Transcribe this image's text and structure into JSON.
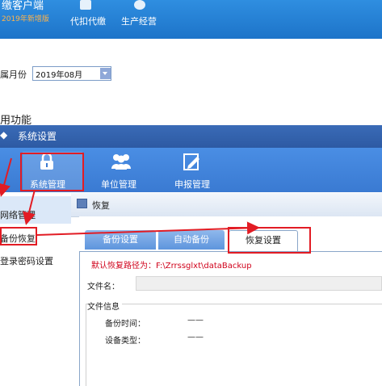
{
  "app_header": {
    "title": "缴客户端",
    "subtitle": "2019年新增版",
    "nav": [
      {
        "label": "代扣代缴"
      },
      {
        "label": "生产经营"
      }
    ]
  },
  "period": {
    "label": "属月份",
    "value": "2019年08月"
  },
  "section_title": "用功能",
  "dialog": {
    "title": "系统设置",
    "toolbar": [
      {
        "label": "系统管理",
        "icon": "lock-icon"
      },
      {
        "label": "单位管理",
        "icon": "users-icon"
      },
      {
        "label": "申报管理",
        "icon": "edit-icon"
      }
    ],
    "sidebar": [
      {
        "label": "网络管理"
      },
      {
        "label": "备份恢复"
      },
      {
        "label": "登录密码设置"
      }
    ],
    "content_title": "恢复",
    "tabs": [
      {
        "label": "备份设置"
      },
      {
        "label": "自动备份"
      },
      {
        "label": "恢复设置"
      }
    ],
    "default_path_text": "默认恢复路径为：F:\\Zrrssglxt\\dataBackup",
    "file_name_label": "文件名：",
    "file_name_value": "",
    "file_info_label": "文件信息",
    "backup_time_label": "备份时间：",
    "backup_time_value": "——",
    "device_type_label": "设备类型：",
    "device_type_value": "——"
  },
  "colors": {
    "header_blue": "#1d74c9",
    "toolbar_blue": "#3a7ad2",
    "annotation_red": "#e21c24",
    "path_text_red": "#d0021b"
  }
}
